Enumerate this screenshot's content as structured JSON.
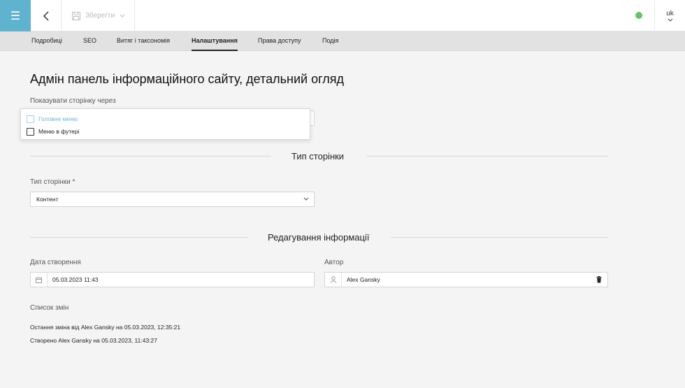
{
  "toolbar": {
    "save_label": "Зберегти",
    "language": "uk",
    "status_color": "#66c16a",
    "accent_color": "#5fb3cf"
  },
  "tabs": [
    {
      "label": "Подробиці",
      "active": false
    },
    {
      "label": "SEO",
      "active": false
    },
    {
      "label": "Витяг і таксономія",
      "active": false
    },
    {
      "label": "Налаштування",
      "active": true
    },
    {
      "label": "Права доступу",
      "active": false
    },
    {
      "label": "Подія",
      "active": false
    }
  ],
  "page": {
    "title": "Адмін панель інформаційного сайту, детальний огляд"
  },
  "display_via": {
    "label": "Показувати сторінку через",
    "options": [
      {
        "label": "Головне меню",
        "checked": false,
        "highlighted": true
      },
      {
        "label": "Меню в футері",
        "checked": false,
        "highlighted": false
      }
    ]
  },
  "page_type_section": {
    "title": "Тип сторінки",
    "field_label": "Тип сторінки *",
    "value": "Контент"
  },
  "edit_info_section": {
    "title": "Редагування інформації",
    "created_label": "Дата створення",
    "created_value": "05.03.2023 11:43",
    "author_label": "Автор",
    "author_value": "Alex Gansky"
  },
  "changes": {
    "label": "Список змін",
    "entries": [
      "Остання зміна від Alex Gansky на 05.03.2023, 12:35:21",
      "Створено Alex Gansky на 05.03.2023, 11:43:27"
    ]
  }
}
